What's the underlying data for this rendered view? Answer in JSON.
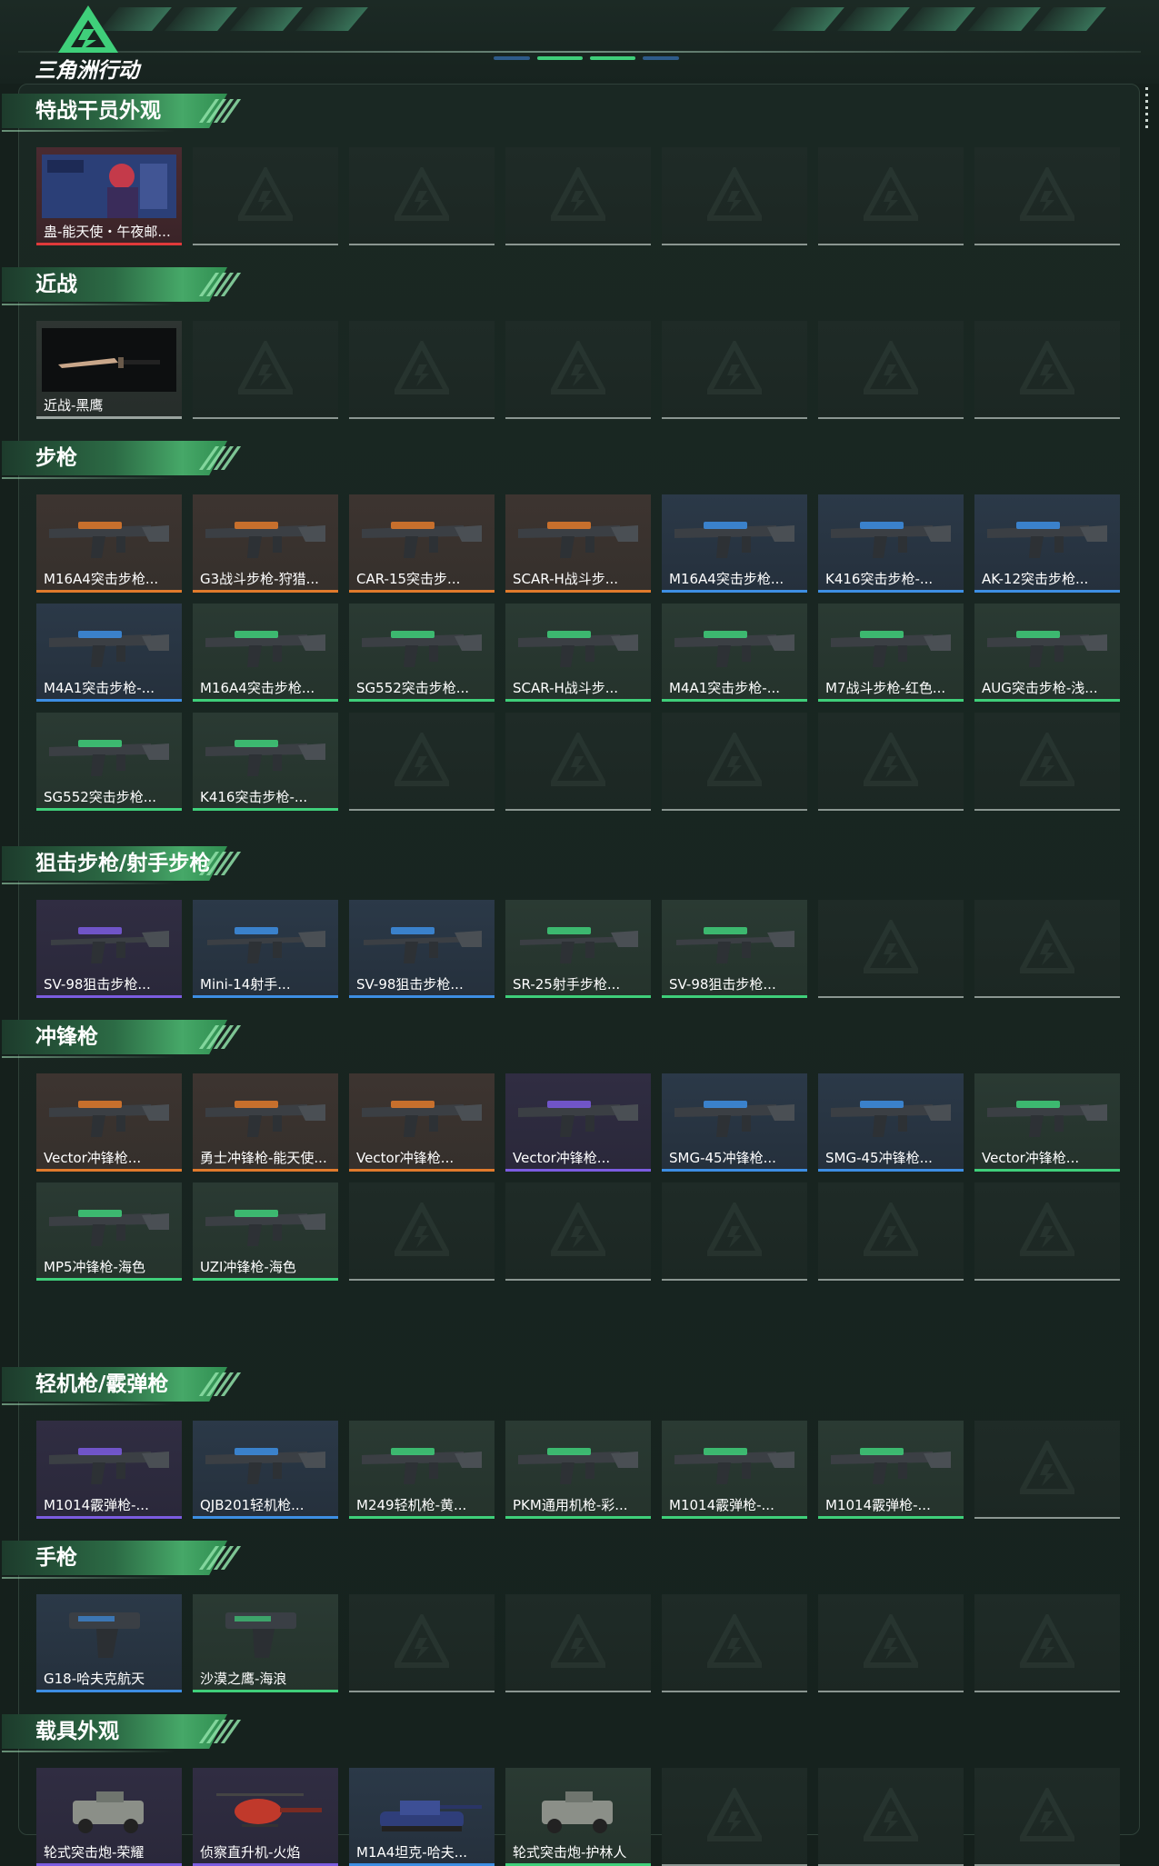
{
  "app": {
    "logo_text": "三角洲行动"
  },
  "sections": [
    {
      "key": "operator",
      "title": "特战干员外观",
      "cards": [
        {
          "label": "蛊-能天使・午夜邮...",
          "rarity": "red",
          "icon": "operator-portrait-icon"
        }
      ]
    },
    {
      "key": "melee",
      "title": "近战",
      "cards": [
        {
          "label": "近战-黑鹰",
          "rarity": "gray",
          "icon": "knife-icon"
        }
      ]
    },
    {
      "key": "rifle",
      "title": "步枪",
      "cards": [
        {
          "label": "M16A4突击步枪...",
          "rarity": "orange",
          "icon": "rifle-icon"
        },
        {
          "label": "G3战斗步枪-狩猎...",
          "rarity": "orange",
          "icon": "rifle-icon"
        },
        {
          "label": "CAR-15突击步...",
          "rarity": "orange",
          "icon": "rifle-icon"
        },
        {
          "label": "SCAR-H战斗步...",
          "rarity": "orange",
          "icon": "rifle-icon"
        },
        {
          "label": "M16A4突击步枪...",
          "rarity": "blue",
          "icon": "rifle-icon"
        },
        {
          "label": "K416突击步枪-...",
          "rarity": "blue",
          "icon": "rifle-icon"
        },
        {
          "label": "AK-12突击步枪...",
          "rarity": "blue",
          "icon": "rifle-icon"
        },
        {
          "label": "M4A1突击步枪-...",
          "rarity": "blue",
          "icon": "rifle-icon"
        },
        {
          "label": "M16A4突击步枪...",
          "rarity": "green",
          "icon": "rifle-icon"
        },
        {
          "label": "SG552突击步枪...",
          "rarity": "green",
          "icon": "rifle-icon"
        },
        {
          "label": "SCAR-H战斗步...",
          "rarity": "green",
          "icon": "rifle-icon"
        },
        {
          "label": "M4A1突击步枪-...",
          "rarity": "green",
          "icon": "rifle-icon"
        },
        {
          "label": "M7战斗步枪-红色...",
          "rarity": "green",
          "icon": "rifle-icon"
        },
        {
          "label": "AUG突击步枪-浅...",
          "rarity": "green",
          "icon": "rifle-icon"
        },
        {
          "label": "SG552突击步枪...",
          "rarity": "green",
          "icon": "rifle-icon"
        },
        {
          "label": "K416突击步枪-...",
          "rarity": "green",
          "icon": "rifle-icon"
        }
      ]
    },
    {
      "key": "sniper",
      "title": "狙击步枪/射手步枪",
      "cards": [
        {
          "label": "SV-98狙击步枪...",
          "rarity": "purple",
          "icon": "sniper-icon"
        },
        {
          "label": "Mini-14射手...",
          "rarity": "blue",
          "icon": "sniper-icon"
        },
        {
          "label": "SV-98狙击步枪...",
          "rarity": "blue",
          "icon": "sniper-icon"
        },
        {
          "label": "SR-25射手步枪...",
          "rarity": "green",
          "icon": "sniper-icon"
        },
        {
          "label": "SV-98狙击步枪...",
          "rarity": "green",
          "icon": "sniper-icon"
        }
      ]
    },
    {
      "key": "smg",
      "title": "冲锋枪",
      "cards": [
        {
          "label": "Vector冲锋枪...",
          "rarity": "orange",
          "icon": "smg-icon"
        },
        {
          "label": "勇士冲锋枪-能天使...",
          "rarity": "orange",
          "icon": "smg-icon"
        },
        {
          "label": "Vector冲锋枪...",
          "rarity": "orange",
          "icon": "smg-icon"
        },
        {
          "label": "Vector冲锋枪...",
          "rarity": "purple",
          "icon": "smg-icon"
        },
        {
          "label": "SMG-45冲锋枪...",
          "rarity": "blue",
          "icon": "smg-icon"
        },
        {
          "label": "SMG-45冲锋枪...",
          "rarity": "blue",
          "icon": "smg-icon"
        },
        {
          "label": "Vector冲锋枪...",
          "rarity": "green",
          "icon": "smg-icon"
        },
        {
          "label": "MP5冲锋枪-海色",
          "rarity": "green",
          "icon": "smg-icon"
        },
        {
          "label": "UZI冲锋枪-海色",
          "rarity": "green",
          "icon": "smg-icon"
        }
      ]
    },
    {
      "key": "lmg",
      "title": "轻机枪/霰弹枪",
      "cards": [
        {
          "label": "M1014霰弹枪-...",
          "rarity": "purple",
          "icon": "shotgun-icon"
        },
        {
          "label": "QJB201轻机枪...",
          "rarity": "blue",
          "icon": "lmg-icon"
        },
        {
          "label": "M249轻机枪-黄...",
          "rarity": "green",
          "icon": "lmg-icon"
        },
        {
          "label": "PKM通用机枪-彩...",
          "rarity": "green",
          "icon": "lmg-icon"
        },
        {
          "label": "M1014霰弹枪-...",
          "rarity": "green",
          "icon": "shotgun-icon"
        },
        {
          "label": "M1014霰弹枪-...",
          "rarity": "green",
          "icon": "shotgun-icon"
        }
      ]
    },
    {
      "key": "pistol",
      "title": "手枪",
      "cards": [
        {
          "label": "G18-哈夫克航天",
          "rarity": "blue",
          "icon": "pistol-icon"
        },
        {
          "label": "沙漠之鹰-海浪",
          "rarity": "green",
          "icon": "pistol-icon"
        }
      ]
    },
    {
      "key": "vehicle",
      "title": "载具外观",
      "cards": [
        {
          "label": "轮式突击炮-荣耀",
          "rarity": "purple",
          "icon": "vehicle-icon"
        },
        {
          "label": "侦察直升机-火焰",
          "rarity": "purple",
          "icon": "helicopter-icon"
        },
        {
          "label": "M1A4坦克-哈夫...",
          "rarity": "blue",
          "icon": "tank-icon"
        },
        {
          "label": "轮式突击炮-护林人",
          "rarity": "green",
          "icon": "vehicle-icon"
        }
      ]
    }
  ],
  "rarity_colors": {
    "orange": "#e07a2c",
    "purple": "#7b5ce0",
    "blue": "#3d8ee3",
    "green": "#3fcf7a",
    "red": "#e03a3a",
    "gray": "#9aa49f"
  }
}
